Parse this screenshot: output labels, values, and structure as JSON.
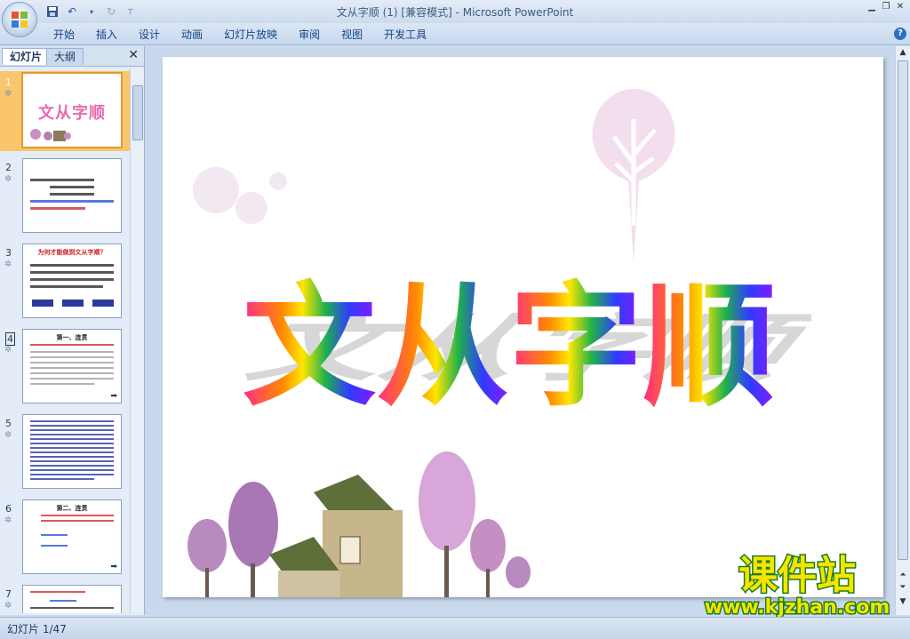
{
  "window": {
    "title": "文从字顺 (1) [兼容模式] - Microsoft PowerPoint"
  },
  "ribbon": {
    "tabs": [
      "开始",
      "插入",
      "设计",
      "动画",
      "幻灯片放映",
      "审阅",
      "视图",
      "开发工具"
    ],
    "help_label": "?"
  },
  "pane": {
    "tab_slides": "幻灯片",
    "tab_outline": "大纲",
    "close_label": "✕",
    "thumbnails": [
      {
        "number": "1",
        "title": "文从字顺"
      },
      {
        "number": "2",
        "title": ""
      },
      {
        "number": "3",
        "title": "为何才能做到文从字顺？"
      },
      {
        "number": "4",
        "title": "第一、连贯"
      },
      {
        "number": "5",
        "title": ""
      },
      {
        "number": "6",
        "title": "第二、连贯"
      },
      {
        "number": "7",
        "title": ""
      }
    ]
  },
  "slide": {
    "title_chars": [
      "文",
      "从",
      "字",
      "顺"
    ]
  },
  "watermark": {
    "line1": "课件站",
    "line2": "www.kjzhan.com"
  },
  "status": {
    "slide_info": "幻灯片 1/47"
  },
  "colors": {
    "char_gradient": [
      "#ff2b8a",
      "#ff8a00",
      "#1fb24a",
      "#6a1bff"
    ],
    "watermark_fill": "#f5e400"
  }
}
